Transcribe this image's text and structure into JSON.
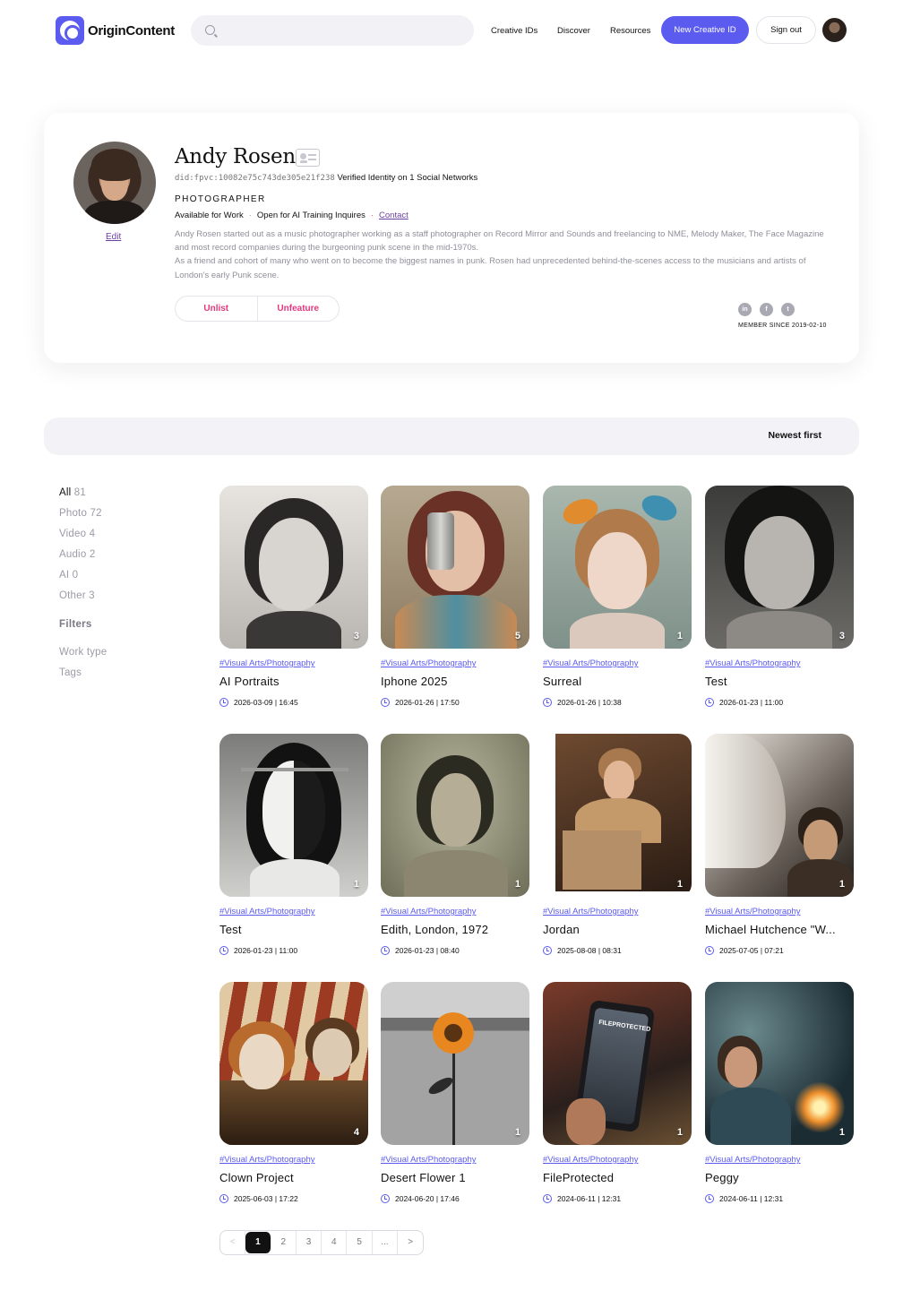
{
  "header": {
    "logo_text": "OriginContent",
    "search_placeholder": "",
    "nav": [
      "Creative IDs",
      "Discover",
      "Resources"
    ],
    "new_button": "New Creative ID",
    "signout_button": "Sign out"
  },
  "profile": {
    "name": "Andy Rosen",
    "did": "did:fpvc:10082e75c743de305e21f238",
    "verified": "Verified Identity on 1 Social Networks",
    "profession": "PHOTOGRAPHER",
    "available": "Available for Work",
    "ai_training": "Open for AI Training Inquires",
    "contact": "Contact",
    "edit": "Edit",
    "bio_1": "Andy Rosen started out as a music photographer working as a staff photographer on Record Mirror and Sounds and freelancing to NME, Melody Maker, The Face Magazine and most record companies during the burgeoning punk scene in the mid-1970s.",
    "bio_2": "As a friend and cohort of many who went on to become the biggest names in punk. Rosen had unprecedented behind-the-scenes access to the musicians and artists of London's early Punk scene.",
    "unlist": "Unlist",
    "unfeature": "Unfeature",
    "social": [
      "linkedin-icon",
      "facebook-icon",
      "twitter-icon"
    ],
    "member_since": "MEMBER SINCE 2019-02-10"
  },
  "sort": {
    "label": "Newest first"
  },
  "sidebar": {
    "types": [
      {
        "label": "All",
        "count": "81"
      },
      {
        "label": "Photo",
        "count": "72"
      },
      {
        "label": "Video",
        "count": "4"
      },
      {
        "label": "Audio",
        "count": "2"
      },
      {
        "label": "AI",
        "count": "0"
      },
      {
        "label": "Other",
        "count": "3"
      }
    ],
    "filters_heading": "Filters",
    "filters": [
      "Work type",
      "Tags"
    ]
  },
  "works": [
    {
      "category": "#Visual Arts/Photography",
      "title": "AI Portraits",
      "date": "2026-03-09 | 16:45",
      "count": "3"
    },
    {
      "category": "#Visual Arts/Photography",
      "title": "Iphone 2025",
      "date": "2026-01-26 | 17:50",
      "count": "5"
    },
    {
      "category": "#Visual Arts/Photography",
      "title": "Surreal",
      "date": "2026-01-26 | 10:38",
      "count": "1"
    },
    {
      "category": "#Visual Arts/Photography",
      "title": "Test",
      "date": "2026-01-23 | 11:00",
      "count": "3"
    },
    {
      "category": "#Visual Arts/Photography",
      "title": "Test",
      "date": "2026-01-23 | 11:00",
      "count": "1"
    },
    {
      "category": "#Visual Arts/Photography",
      "title": "Edith, London, 1972",
      "date": "2026-01-23 | 08:40",
      "count": "1"
    },
    {
      "category": "#Visual Arts/Photography",
      "title": "Jordan",
      "date": "2025-08-08 | 08:31",
      "count": "1"
    },
    {
      "category": "#Visual Arts/Photography",
      "title": "Michael Hutchence \"W...",
      "date": "2025-07-05 | 07:21",
      "count": "1"
    },
    {
      "category": "#Visual Arts/Photography",
      "title": "Clown Project",
      "date": "2025-06-03 | 17:22",
      "count": "4"
    },
    {
      "category": "#Visual Arts/Photography",
      "title": "Desert Flower 1",
      "date": "2024-06-20 | 17:46",
      "count": "1"
    },
    {
      "category": "#Visual Arts/Photography",
      "title": "FileProtected",
      "date": "2024-06-11 | 12:31",
      "count": "1"
    },
    {
      "category": "#Visual Arts/Photography",
      "title": "Peggy",
      "date": "2024-06-11 | 12:31",
      "count": "1"
    }
  ],
  "thumb_text": {
    "fileprotected": "FILEPROTECTED"
  },
  "pagination": {
    "prev": "<",
    "pages": [
      "1",
      "2",
      "3",
      "4",
      "5",
      "..."
    ],
    "next": ">",
    "current": 1
  },
  "colors": {
    "accent": "#5b5bf0",
    "pink": "#e4387f",
    "purple_link": "#6b3fa0"
  }
}
